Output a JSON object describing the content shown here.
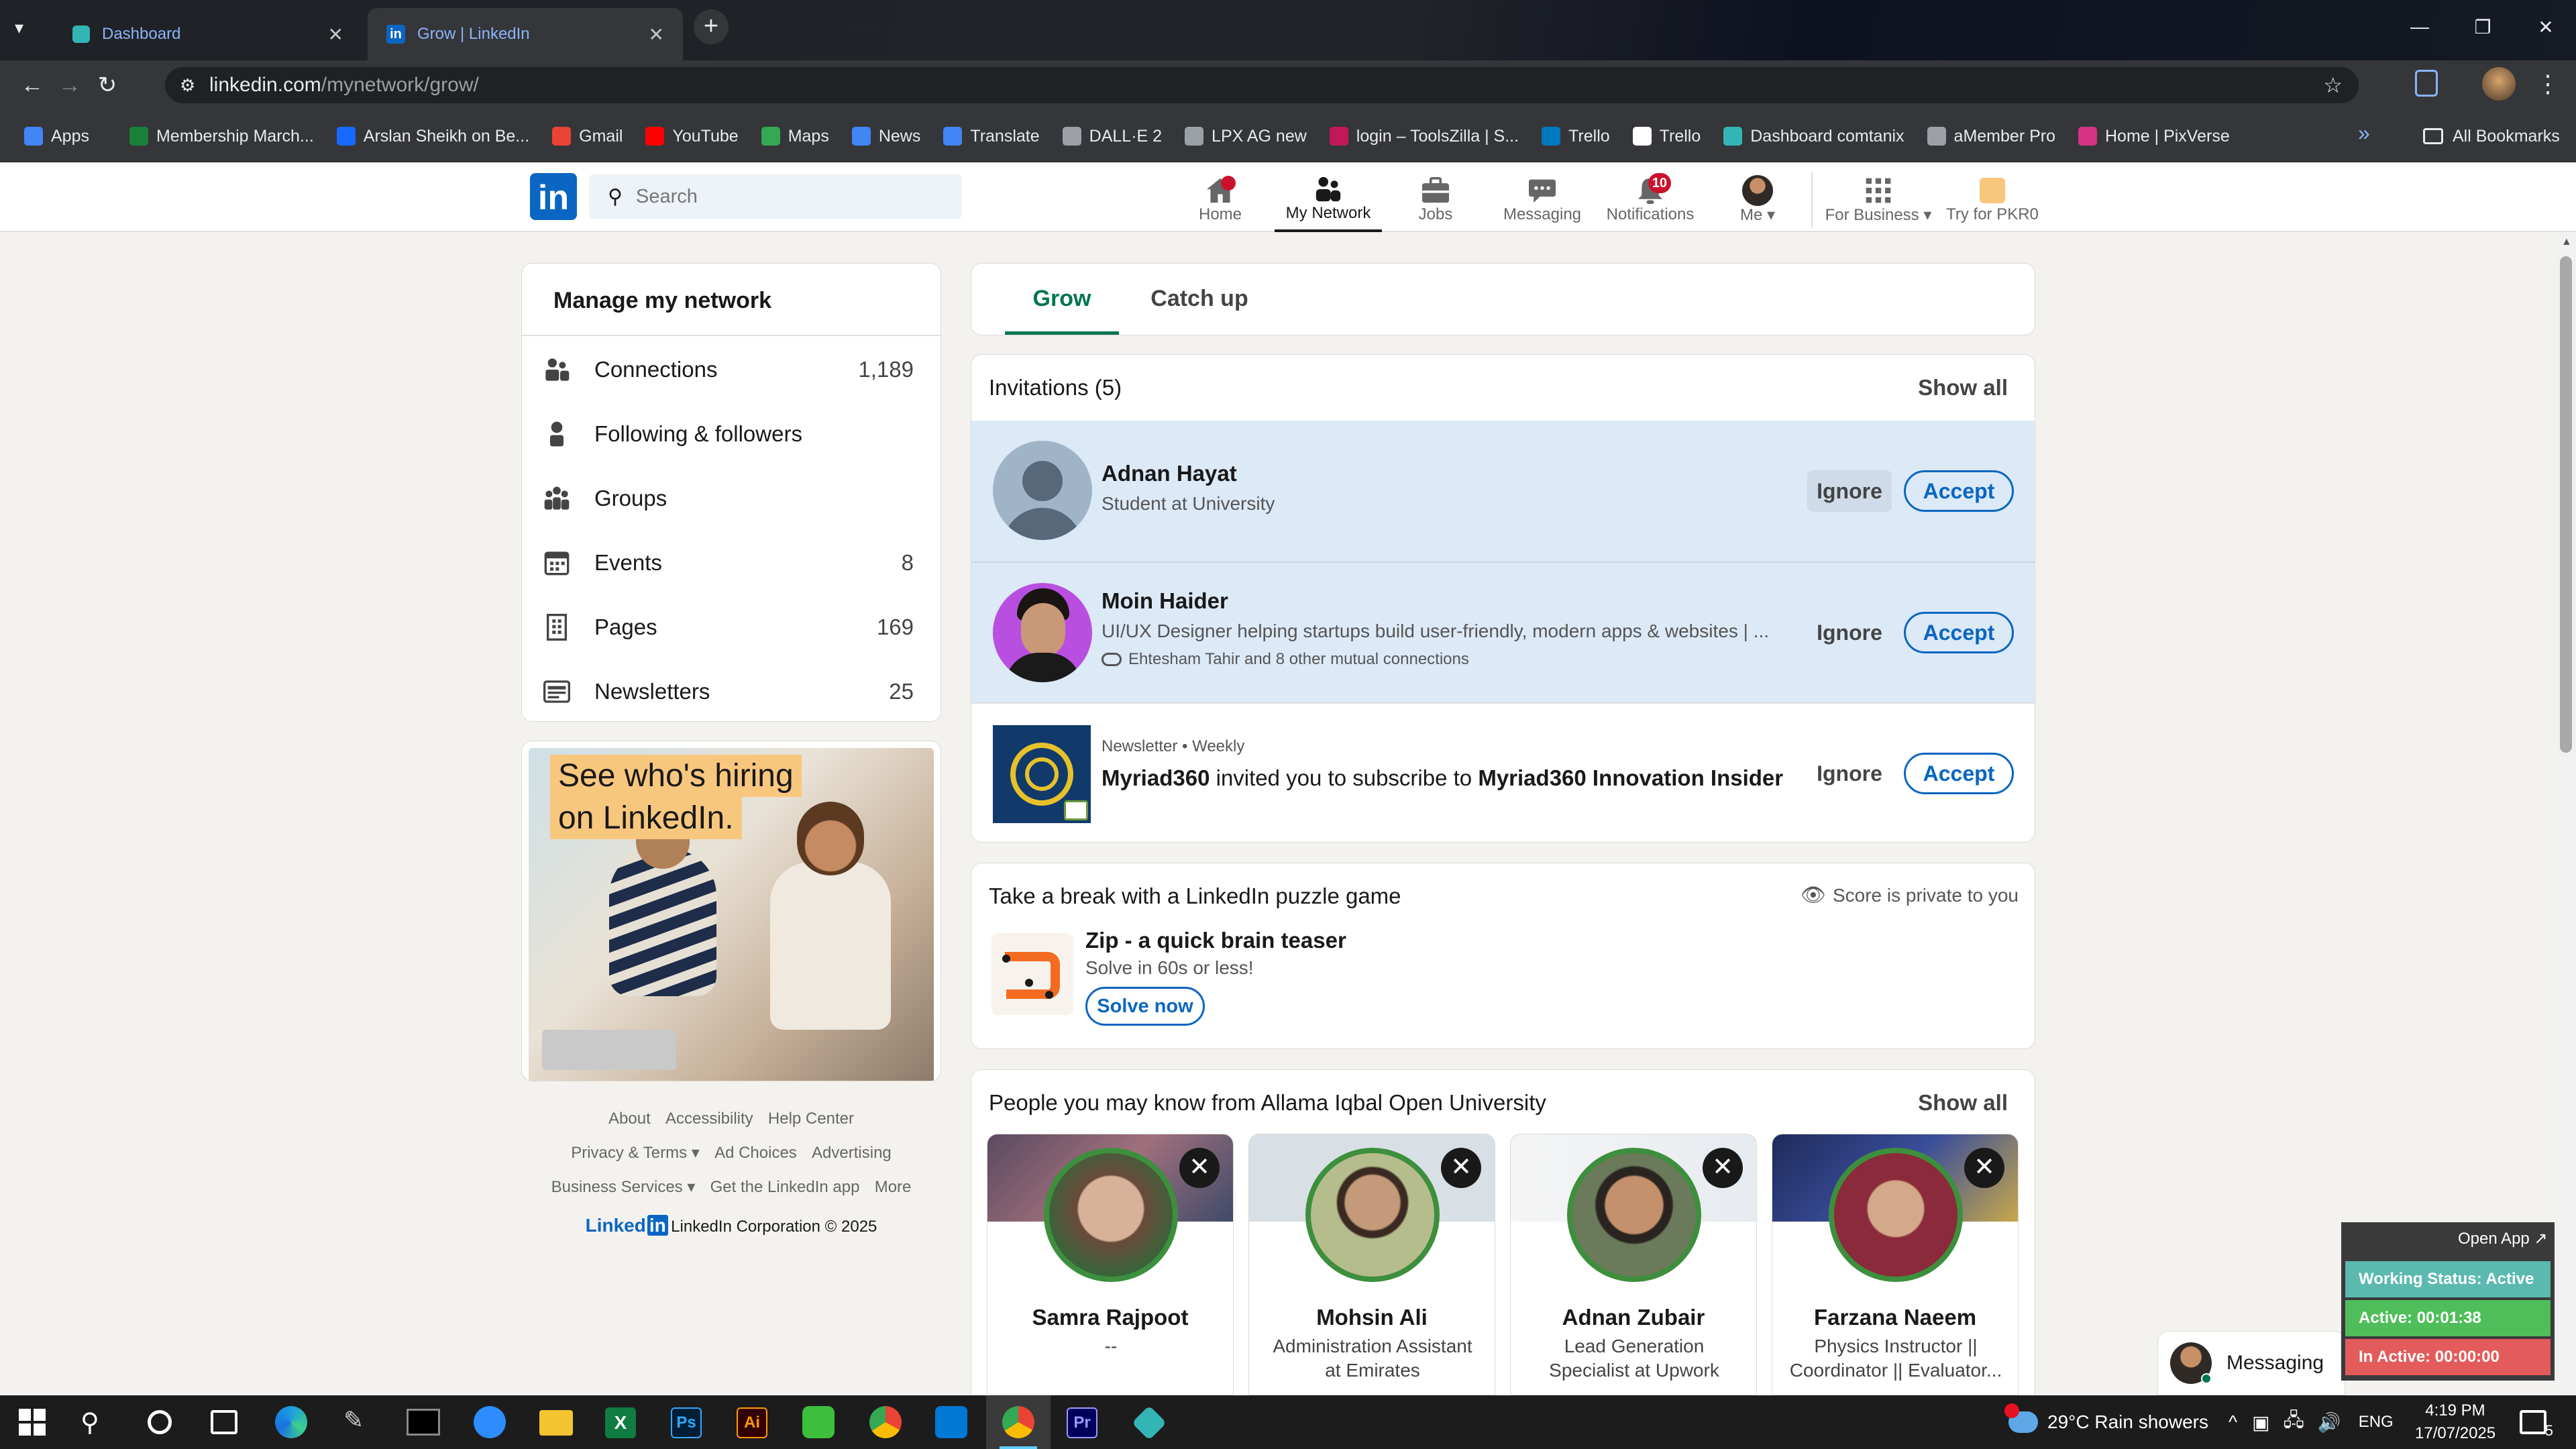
{
  "browser": {
    "tabs": [
      {
        "label": "Dashboard",
        "active": false
      },
      {
        "label": "Grow | LinkedIn",
        "active": true
      }
    ],
    "url_host": "linkedin.com",
    "url_path": "/mynetwork/grow/",
    "bookmarks": [
      {
        "label": "Apps",
        "color": "#4285f4"
      },
      {
        "label": "Membership March...",
        "color": "#188038"
      },
      {
        "label": "Arslan Sheikh on Be...",
        "color": "#1769ff"
      },
      {
        "label": "Gmail",
        "color": "#ea4335"
      },
      {
        "label": "YouTube",
        "color": "#ff0000"
      },
      {
        "label": "Maps",
        "color": "#34a853"
      },
      {
        "label": "News",
        "color": "#4285f4"
      },
      {
        "label": "Translate",
        "color": "#4285f4"
      },
      {
        "label": "DALL·E 2",
        "color": "#9aa0a6"
      },
      {
        "label": "LPX AG new",
        "color": "#9aa0a6"
      },
      {
        "label": "login – ToolsZilla | S...",
        "color": "#c2185b"
      },
      {
        "label": "Trello",
        "color": "#0079bf"
      },
      {
        "label": "Trello",
        "color": "#ffffff"
      },
      {
        "label": "Dashboard comtanix",
        "color": "#33b5b5"
      },
      {
        "label": "aMember Pro",
        "color": "#9aa0a6"
      },
      {
        "label": "Home | PixVerse",
        "color": "#d63384"
      }
    ],
    "all_bookmarks": "All Bookmarks"
  },
  "nav": {
    "search_placeholder": "Search",
    "items": [
      {
        "label": "Home",
        "icon": "home-icon",
        "badge": ""
      },
      {
        "label": "My Network",
        "icon": "network-icon",
        "badge": ""
      },
      {
        "label": "Jobs",
        "icon": "briefcase-icon",
        "badge": ""
      },
      {
        "label": "Messaging",
        "icon": "chat-icon",
        "badge": ""
      },
      {
        "label": "Notifications",
        "icon": "bell-icon",
        "badge": "10"
      },
      {
        "label": "Me",
        "icon": "avatar",
        "badge": ""
      }
    ],
    "business": "For Business",
    "premium": "Try for PKR0"
  },
  "sidebar": {
    "title": "Manage my network",
    "items": [
      {
        "label": "Connections",
        "count": "1,189"
      },
      {
        "label": "Following & followers",
        "count": ""
      },
      {
        "label": "Groups",
        "count": ""
      },
      {
        "label": "Events",
        "count": "8"
      },
      {
        "label": "Pages",
        "count": "169"
      },
      {
        "label": "Newsletters",
        "count": "25"
      }
    ],
    "ad_line1": "See who's hiring",
    "ad_line2": "on LinkedIn."
  },
  "footer": {
    "row1": [
      "About",
      "Accessibility",
      "Help Center"
    ],
    "row2": [
      "Privacy & Terms",
      "Ad Choices",
      "Advertising"
    ],
    "row3": [
      "Business Services",
      "Get the LinkedIn app",
      "More"
    ],
    "logo": "Linked",
    "copyright": "LinkedIn Corporation © 2025"
  },
  "tabs": {
    "grow": "Grow",
    "catchup": "Catch up"
  },
  "invitations": {
    "title": "Invitations (5)",
    "show_all": "Show all",
    "ignore": "Ignore",
    "accept": "Accept",
    "items": [
      {
        "name": "Adnan Hayat",
        "headline": "Student at University",
        "mutual": ""
      },
      {
        "name": "Moin Haider",
        "headline": "UI/UX Designer helping startups build user-friendly, modern apps & websites | ...",
        "mutual": "Ehtesham Tahir and 8 other mutual connections"
      }
    ],
    "newsletter": {
      "meta": "Newsletter • Weekly",
      "sender": "Myriad360",
      "middle": " invited you to subscribe to ",
      "target": "Myriad360 Innovation Insider"
    }
  },
  "puzzle": {
    "title": "Take a break with a LinkedIn puzzle game",
    "private": "Score is private to you",
    "game": "Zip - a quick brain teaser",
    "sub": "Solve in 60s or less!",
    "cta": "Solve now"
  },
  "pymk": {
    "title": "People you may know from Allama Iqbal Open University",
    "show_all": "Show all",
    "people": [
      {
        "name": "Samra Rajpoot",
        "sub": "--"
      },
      {
        "name": "Mohsin Ali",
        "sub": "Administration Assistant at Emirates"
      },
      {
        "name": "Adnan Zubair",
        "sub": "Lead Generation Specialist at Upwork"
      },
      {
        "name": "Farzana Naeem",
        "sub": "Physics Instructor || Coordinator || Evaluator..."
      }
    ]
  },
  "messaging_bar": "Messaging",
  "widget": {
    "open_app": "Open App ↗",
    "status": "Working Status: Active",
    "active": "Active: 00:01:38",
    "inactive": "In Active: 00:00:00"
  },
  "taskbar": {
    "weather": "29°C  Rain showers",
    "lang": "ENG",
    "time": "4:19 PM",
    "date": "17/07/2025",
    "notif_count": "5"
  }
}
